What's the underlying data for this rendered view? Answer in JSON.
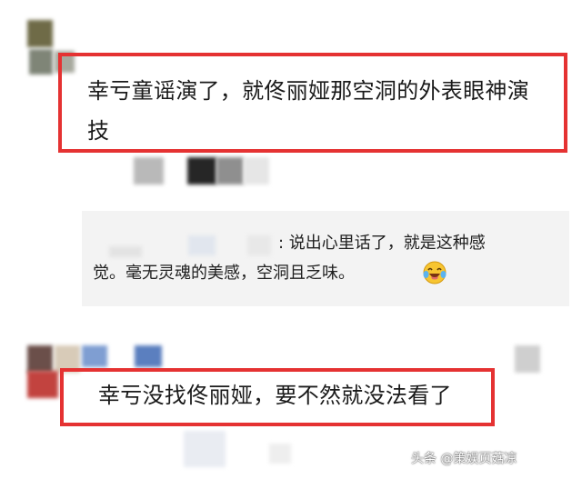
{
  "comments": [
    {
      "text": "幸亏童谣演了，就佟丽娅那空洞的外表眼神演\n技"
    },
    {
      "text": "幸亏没找佟丽娅，要不然就没法看了"
    }
  ],
  "reply": {
    "line1": ": 说出心里话了，就是这种感",
    "line2": "觉。毫无灵魂的美感，空洞且乏味。"
  },
  "emoji": "crying-laughing-emoji",
  "watermark": "头条 @策娱页菇凉",
  "colors": {
    "highlight_border": "#e53232",
    "reply_bg": "#f3f3f3"
  }
}
